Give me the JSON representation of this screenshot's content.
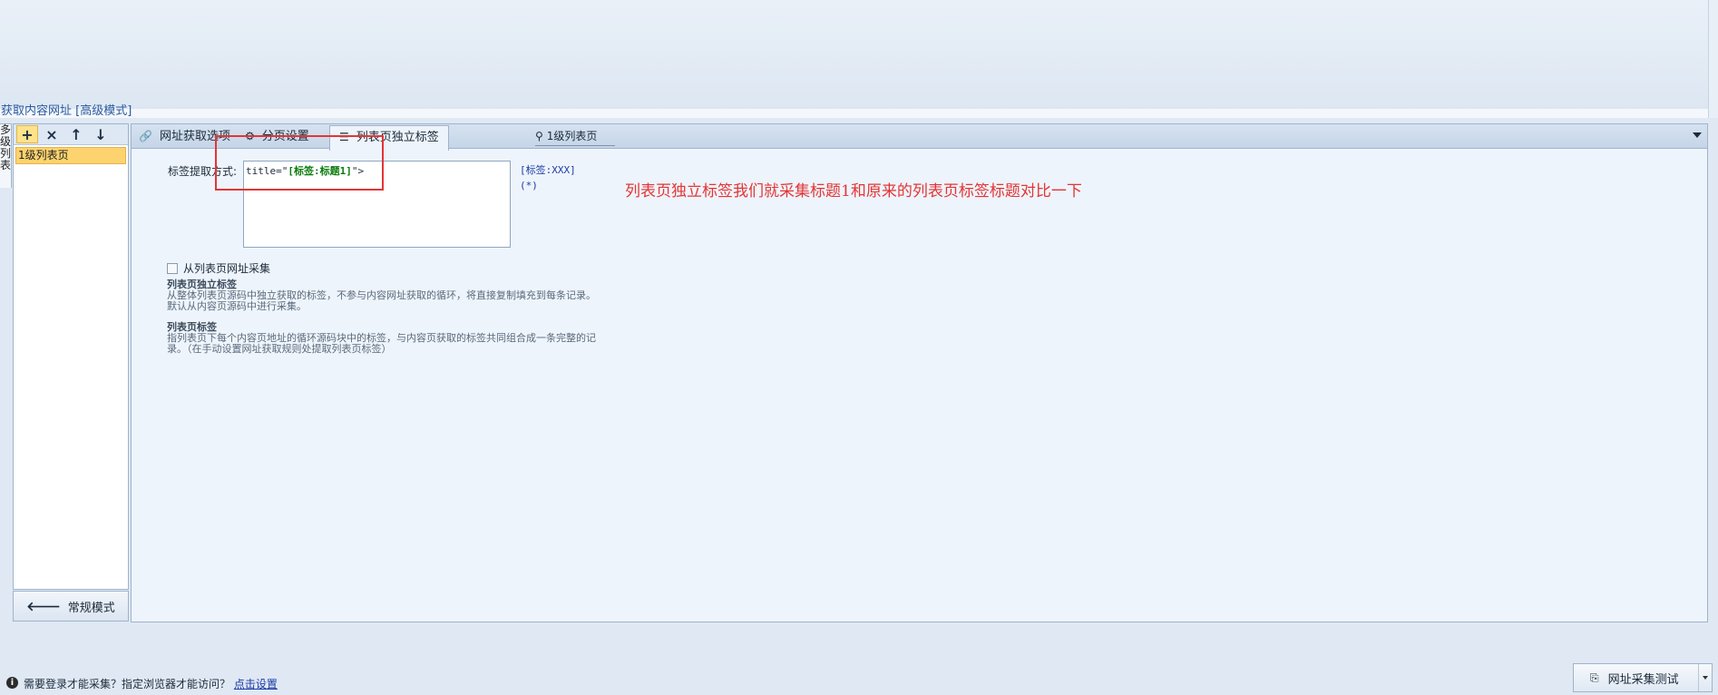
{
  "section_title": "获取内容网址 [高级模式]",
  "vertical_strip": [
    "多",
    "级",
    "列",
    "表"
  ],
  "tree": {
    "toolbar": {
      "add": "+",
      "delete": "×",
      "up": "↑",
      "down": "↓"
    },
    "items": [
      {
        "label": "1级列表页"
      }
    ]
  },
  "normal_mode_button": "常规模式",
  "tabs": [
    {
      "label": "网址获取选项",
      "icon": "link-icon"
    },
    {
      "label": "分页设置",
      "icon": "gears-icon"
    },
    {
      "label": "列表页独立标签",
      "icon": "list-icon",
      "active": true
    }
  ],
  "page_tab": {
    "label": "1级列表页",
    "icon": "pin-icon"
  },
  "extract": {
    "label": "标签提取方式:",
    "code_prefix": "title=\"",
    "code_tag": "[标签:标题1]",
    "code_suffix": "\">"
  },
  "side_hints": [
    "[标签:XXX]",
    "(*)"
  ],
  "annotation": "列表页独立标签我们就采集标题1和原来的列表页标签标题对比一下",
  "checkbox": {
    "label": "从列表页网址采集",
    "checked": false
  },
  "descriptions": [
    {
      "title": "列表页独立标签",
      "text": "从整体列表页源码中独立获取的标签，不参与内容网址获取的循环，将直接复制填充到每条记录。默认从内容页源码中进行采集。"
    },
    {
      "title": "列表页标签",
      "text": "指列表页下每个内容页地址的循环源码块中的标签，与内容页获取的标签共同组合成一条完整的记录。（在手动设置网址获取规则处提取列表页标签）"
    }
  ],
  "bottom": {
    "login_note": "需要登录才能采集？指定浏览器才能访问？",
    "login_link": "点击设置",
    "test_button": "网址采集测试"
  },
  "colors": {
    "accent_red": "#e33535",
    "link_blue": "#1a3aa8",
    "selected_item": "#fcd36e"
  }
}
